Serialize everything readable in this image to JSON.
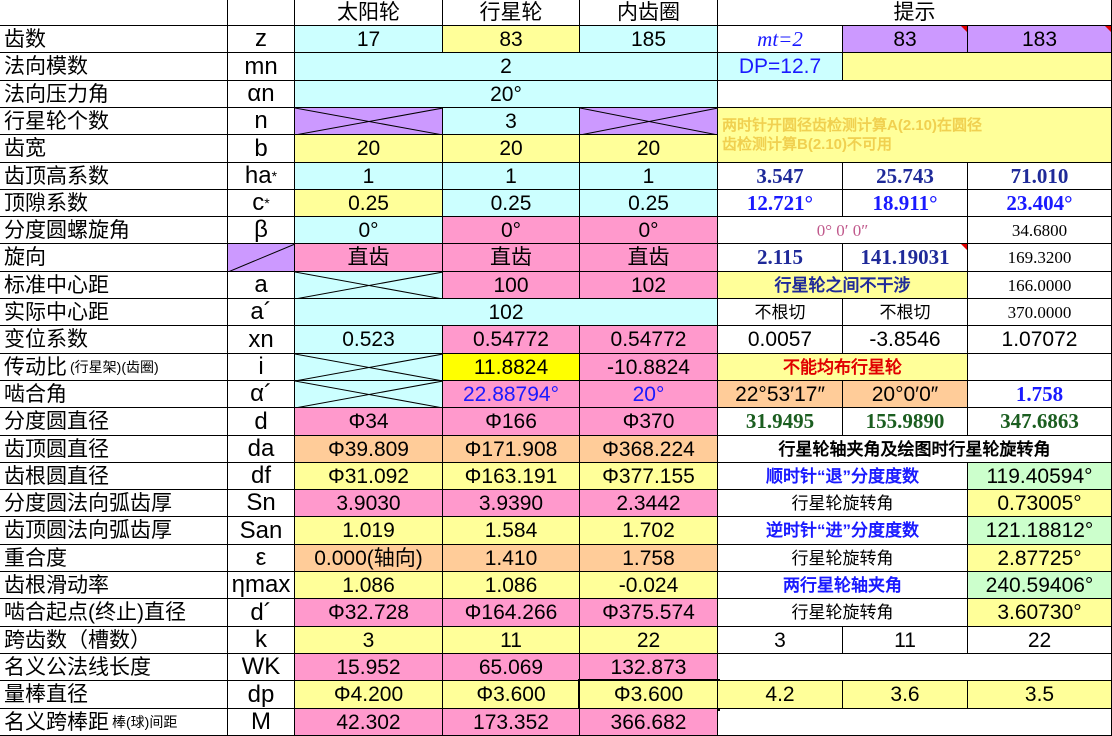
{
  "header": {
    "sun": "太阳轮",
    "planet": "行星轮",
    "ring": "内齿圈",
    "hint": "提示"
  },
  "rows": [
    {
      "name": "齿数",
      "sym": "z",
      "v": [
        "17",
        "83",
        "185"
      ],
      "hint": [
        "mt=2",
        "83",
        "183"
      ]
    },
    {
      "name": "法向模数",
      "sym": "mn",
      "v": [
        "2"
      ],
      "hint": [
        "DP=12.7",
        ""
      ]
    },
    {
      "name": "法向压力角",
      "sym": "αn",
      "v": [
        "20°"
      ]
    },
    {
      "name": "行星轮个数",
      "sym": "n",
      "v": [
        "",
        "3",
        ""
      ],
      "hint_note": [
        "两时针开圆径齿检测计算A(2.10)在圆径",
        "齿检测计算B(2.10)不可用"
      ]
    },
    {
      "name": "齿宽",
      "sym": "b",
      "v": [
        "20",
        "20",
        "20"
      ]
    },
    {
      "name": "齿顶高系数",
      "sym": "ha",
      "sup": "*",
      "v": [
        "1",
        "1",
        "1"
      ],
      "hint": [
        "3.547",
        "25.743",
        "71.010"
      ]
    },
    {
      "name": "顶隙系数",
      "sym": "c",
      "sup": "*",
      "v": [
        "0.25",
        "0.25",
        "0.25"
      ],
      "hint": [
        "12.721°",
        "18.911°",
        "23.404°"
      ]
    },
    {
      "name": "分度圆螺旋角",
      "sym": "β",
      "v": [
        "0°",
        "0°",
        "0°"
      ],
      "hint": [
        "0° 0′ 0″",
        "34.6800"
      ]
    },
    {
      "name": "旋向",
      "sym": "",
      "v": [
        "直齿",
        "直齿",
        "直齿"
      ],
      "hint": [
        "2.115",
        "141.19031",
        "169.3200"
      ]
    },
    {
      "name": "标准中心距",
      "sym": "a",
      "v": [
        "",
        "100",
        "102"
      ],
      "hint": [
        "行星轮之间不干涉",
        "166.0000"
      ]
    },
    {
      "name": "实际中心距",
      "sym": "a´",
      "v": [
        "102"
      ],
      "hint": [
        "不根切",
        "不根切",
        "370.0000"
      ]
    },
    {
      "name": "变位系数",
      "sym": "xn",
      "v": [
        "0.523",
        "0.54772",
        "0.54772"
      ],
      "hint": [
        "0.0057",
        "-3.8546",
        "1.07072"
      ]
    },
    {
      "name": "传动比",
      "name_note": "(行星架)(齿圈)",
      "sym": "i",
      "v": [
        "",
        "11.8824",
        "-10.8824"
      ],
      "hint": [
        "不能均布行星轮",
        ""
      ]
    },
    {
      "name": "啮合角",
      "sym": "α´",
      "v": [
        "",
        "22.88794°",
        "20°"
      ],
      "hint": [
        "22°53′17″",
        "20°0′0″",
        "1.758"
      ]
    },
    {
      "name": "分度圆直径",
      "sym": "d",
      "v": [
        "Φ34",
        "Φ166",
        "Φ370"
      ],
      "hint": [
        "31.9495",
        "155.9890",
        "347.6863"
      ]
    },
    {
      "name": "齿顶圆直径",
      "sym": "da",
      "v": [
        "Φ39.809",
        "Φ171.908",
        "Φ368.224"
      ],
      "hint": [
        "行星轮轴夹角及绘图时行星轮旋转角"
      ]
    },
    {
      "name": "齿根圆直径",
      "sym": "df",
      "v": [
        "Φ31.092",
        "Φ163.191",
        "Φ377.155"
      ],
      "hint": [
        "顺时针“退”分度度数",
        "119.40594°"
      ]
    },
    {
      "name": "分度圆法向弧齿厚",
      "sym": "Sn",
      "v": [
        "3.9030",
        "3.9390",
        "2.3442"
      ],
      "hint": [
        "行星轮旋转角",
        "0.73005°"
      ]
    },
    {
      "name": "齿顶圆法向弧齿厚",
      "sym": "San",
      "v": [
        "1.019",
        "1.584",
        "1.702"
      ],
      "hint": [
        "逆时针“进”分度度数",
        "121.18812°"
      ]
    },
    {
      "name": "重合度",
      "sym": "ε",
      "v": [
        "0.000(轴向)",
        "1.410",
        "1.758"
      ],
      "hint": [
        "行星轮旋转角",
        "2.87725°"
      ]
    },
    {
      "name": "齿根滑动率",
      "sym": "ηmax",
      "v": [
        "1.086",
        "1.086",
        "-0.024"
      ],
      "hint": [
        "两行星轮轴夹角",
        "240.59406°"
      ]
    },
    {
      "name": "啮合起点(终止)直径",
      "sym": "d´",
      "v": [
        "Φ32.728",
        "Φ164.266",
        "Φ375.574"
      ],
      "hint": [
        "行星轮旋转角",
        "3.60730°"
      ]
    },
    {
      "name": "跨齿数（槽数）",
      "sym": "k",
      "v": [
        "3",
        "11",
        "22"
      ],
      "hint": [
        "3",
        "11",
        "22"
      ]
    },
    {
      "name": "名义公法线长度",
      "sym": "WK",
      "v": [
        "15.952",
        "65.069",
        "132.873"
      ]
    },
    {
      "name": "量棒直径",
      "sym": "dp",
      "v": [
        "Φ4.200",
        "Φ3.600",
        "Φ3.600"
      ],
      "hint": [
        "4.2",
        "3.6",
        "3.5"
      ]
    },
    {
      "name": "名义跨棒距",
      "name_note": "棒(球)间距",
      "sym": "M",
      "v": [
        "42.302",
        "173.352",
        "366.682"
      ]
    }
  ]
}
